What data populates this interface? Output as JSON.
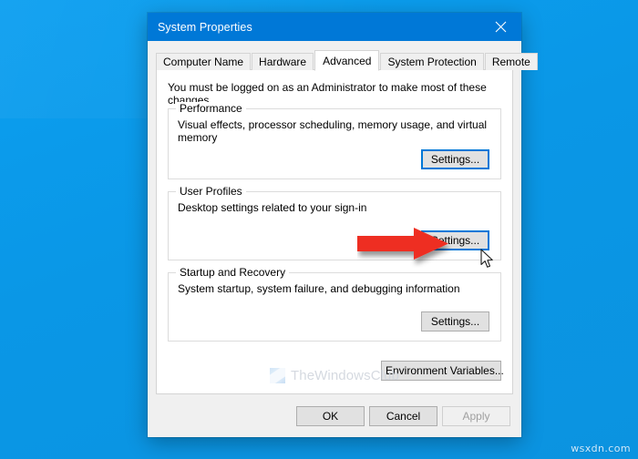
{
  "desktop": {
    "background_color": "#0a9bea",
    "watermark": "wsxdn.com"
  },
  "window": {
    "title": "System Properties",
    "close_icon": "close-icon",
    "titlebar_color": "#0078d7"
  },
  "tabs": [
    {
      "label": "Computer Name",
      "selected": false
    },
    {
      "label": "Hardware",
      "selected": false
    },
    {
      "label": "Advanced",
      "selected": true
    },
    {
      "label": "System Protection",
      "selected": false
    },
    {
      "label": "Remote",
      "selected": false
    }
  ],
  "advanced_page": {
    "admin_note": "You must be logged on as an Administrator to make most of these changes.",
    "groups": [
      {
        "title": "Performance",
        "description": "Visual effects, processor scheduling, memory usage, and virtual memory",
        "button_label": "Settings...",
        "button_focused": true
      },
      {
        "title": "User Profiles",
        "description": "Desktop settings related to your sign-in",
        "button_label": "Settings...",
        "button_focused": true
      },
      {
        "title": "Startup and Recovery",
        "description": "System startup, system failure, and debugging information",
        "button_label": "Settings...",
        "button_focused": false
      }
    ],
    "environment_variables_label": "Environment Variables...",
    "watermark_text": "TheWindowsClub",
    "watermark_logo": "thewindowsclub-logo-icon"
  },
  "footer": {
    "ok_label": "OK",
    "cancel_label": "Cancel",
    "apply_label": "Apply",
    "apply_disabled": true
  },
  "annotations": {
    "arrow": {
      "name": "red-arrow-annotation",
      "color": "#ee2d24",
      "points_to": "User Profiles Settings... button"
    },
    "cursor": {
      "name": "mouse-pointer-cursor"
    }
  },
  "colors": {
    "accent": "#0078d7",
    "desktop": "#0a9bea",
    "dialog_face": "#f0f0f0",
    "page_face": "#ffffff",
    "button_face": "#e1e1e1",
    "arrow_red": "#ee2d24"
  }
}
